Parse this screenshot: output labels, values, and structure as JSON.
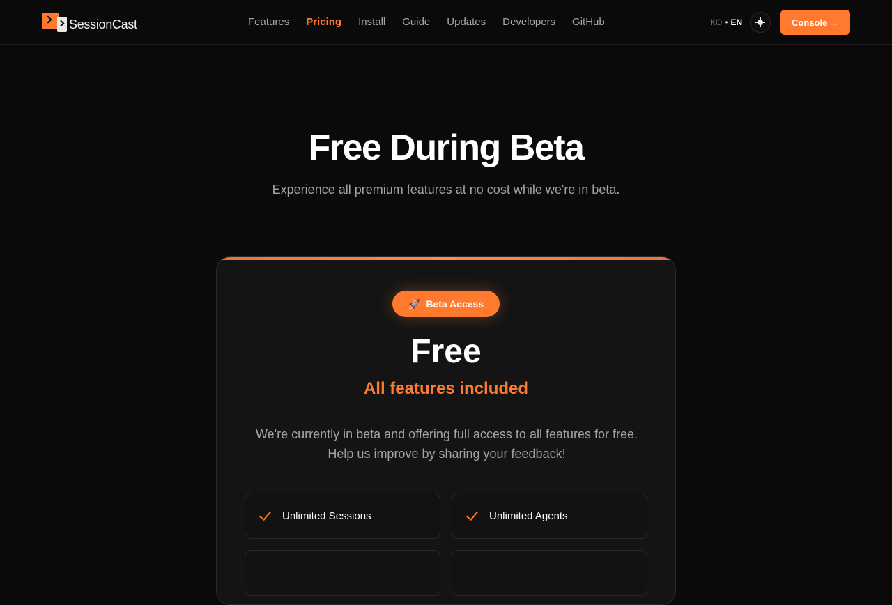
{
  "header": {
    "logo_text": "SessionCast",
    "nav": [
      {
        "label": "Features",
        "active": false
      },
      {
        "label": "Pricing",
        "active": true
      },
      {
        "label": "Install",
        "active": false
      },
      {
        "label": "Guide",
        "active": false
      },
      {
        "label": "Updates",
        "active": false
      },
      {
        "label": "Developers",
        "active": false
      },
      {
        "label": "GitHub",
        "active": false
      }
    ],
    "lang": {
      "ko": "KO",
      "separator": "•",
      "en": "EN"
    },
    "theme_icon": "sun-icon",
    "console_label": "Console →"
  },
  "hero": {
    "title": "Free During Beta",
    "subtitle": "Experience all premium features at no cost while we're in beta."
  },
  "card": {
    "badge_icon": "🚀",
    "badge_label": "Beta Access",
    "price": "Free",
    "price_sub": "All features included",
    "description_line1": "We're currently in beta and offering full access to all features for free.",
    "description_line2": "Help us improve by sharing your feedback!",
    "features": [
      {
        "label": "Unlimited Sessions"
      },
      {
        "label": "Unlimited Agents"
      },
      {
        "label": ""
      },
      {
        "label": ""
      }
    ]
  },
  "colors": {
    "accent": "#ff7a2f",
    "background": "#0a0a0a",
    "card": "#141414"
  }
}
